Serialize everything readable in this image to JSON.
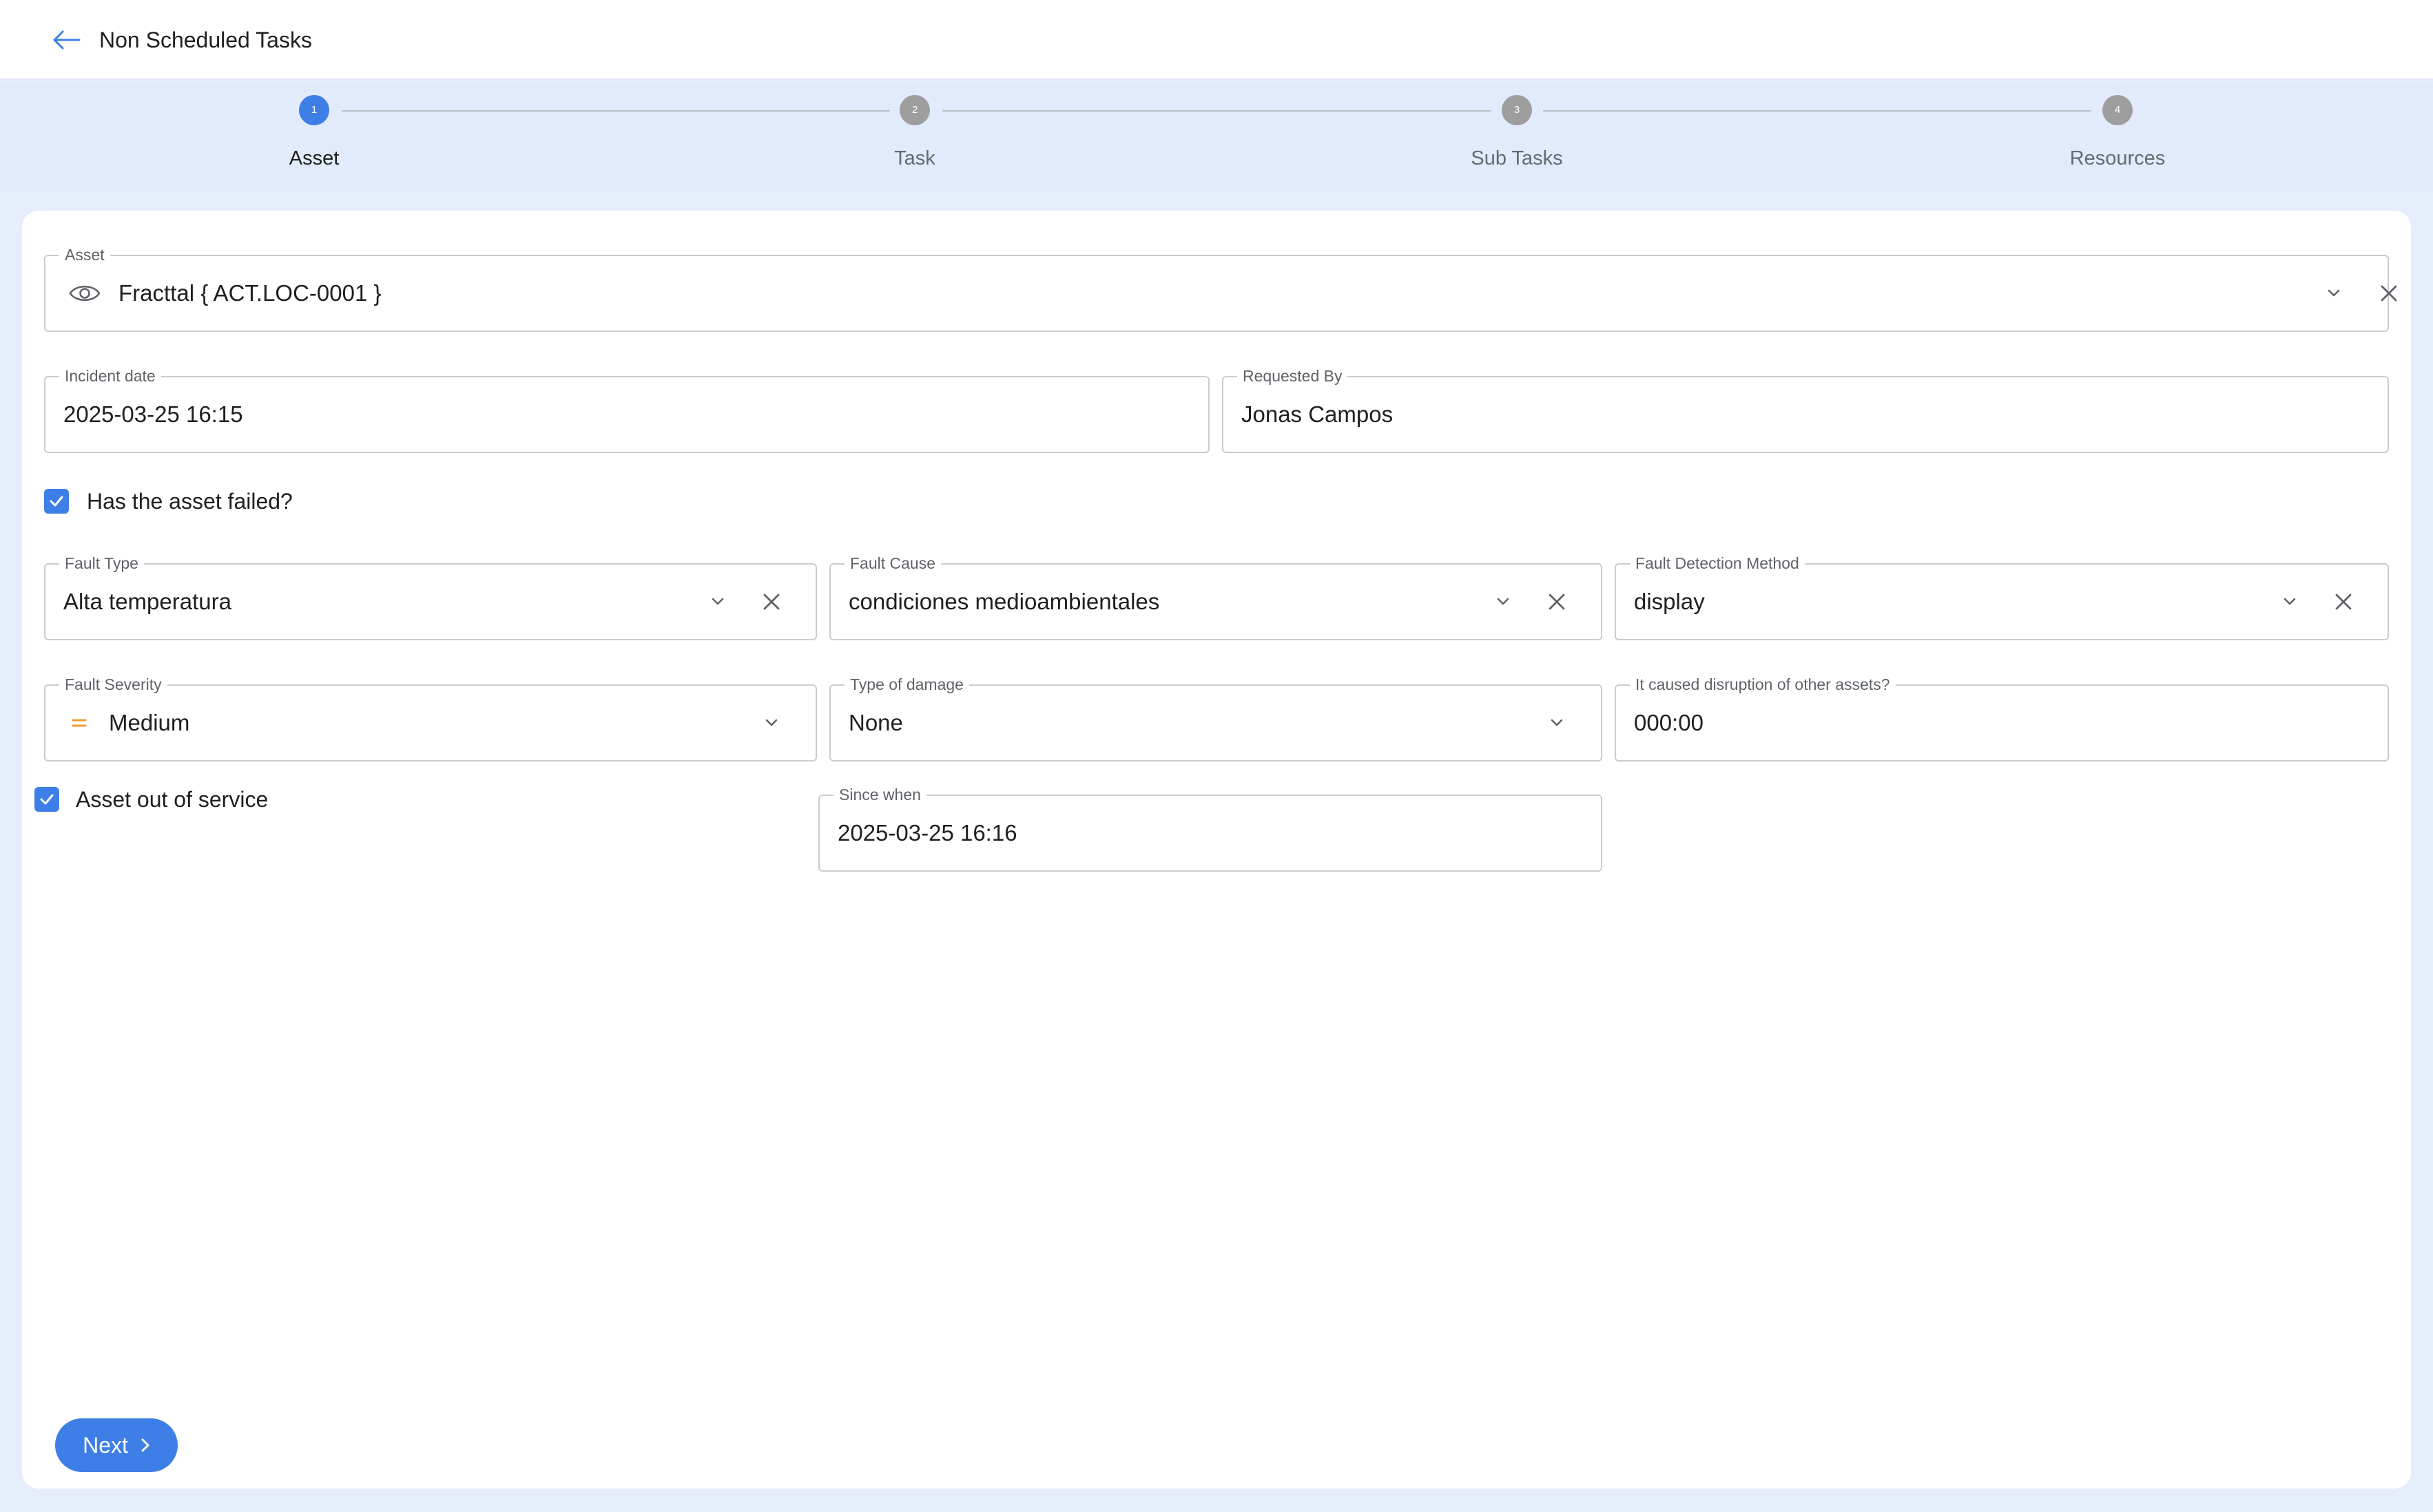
{
  "header": {
    "title": "Non Scheduled Tasks"
  },
  "stepper": {
    "steps": [
      {
        "number": "1",
        "label": "Asset"
      },
      {
        "number": "2",
        "label": "Task"
      },
      {
        "number": "3",
        "label": "Sub Tasks"
      },
      {
        "number": "4",
        "label": "Resources"
      }
    ],
    "active_step": 1
  },
  "form": {
    "asset": {
      "label": "Asset",
      "value": "Fracttal { ACT.LOC-0001 }"
    },
    "incident_date": {
      "label": "Incident date",
      "value": "2025-03-25 16:15"
    },
    "requested_by": {
      "label": "Requested By",
      "value": "Jonas Campos"
    },
    "asset_failed": {
      "label": "Has the asset failed?",
      "checked": true
    },
    "fault_type": {
      "label": "Fault Type",
      "value": "Alta temperatura"
    },
    "fault_cause": {
      "label": "Fault Cause",
      "value": "condiciones medioambientales"
    },
    "fault_detection_method": {
      "label": "Fault Detection Method",
      "value": "display"
    },
    "fault_severity": {
      "label": "Fault Severity",
      "value": "Medium",
      "icon": "equals-icon",
      "icon_color": "#f29a2e"
    },
    "type_of_damage": {
      "label": "Type of damage",
      "value": "None"
    },
    "disruption": {
      "label": "It caused disruption of other assets?",
      "value": "000:00"
    },
    "out_of_service": {
      "label": "Asset out of service",
      "checked": true
    },
    "since_when": {
      "label": "Since when",
      "value": "2025-03-25 16:16"
    }
  },
  "actions": {
    "next_label": "Next"
  },
  "colors": {
    "accent": "#3d7fe6",
    "background": "#e6eefb",
    "inactive_step": "#9e9e9e"
  }
}
